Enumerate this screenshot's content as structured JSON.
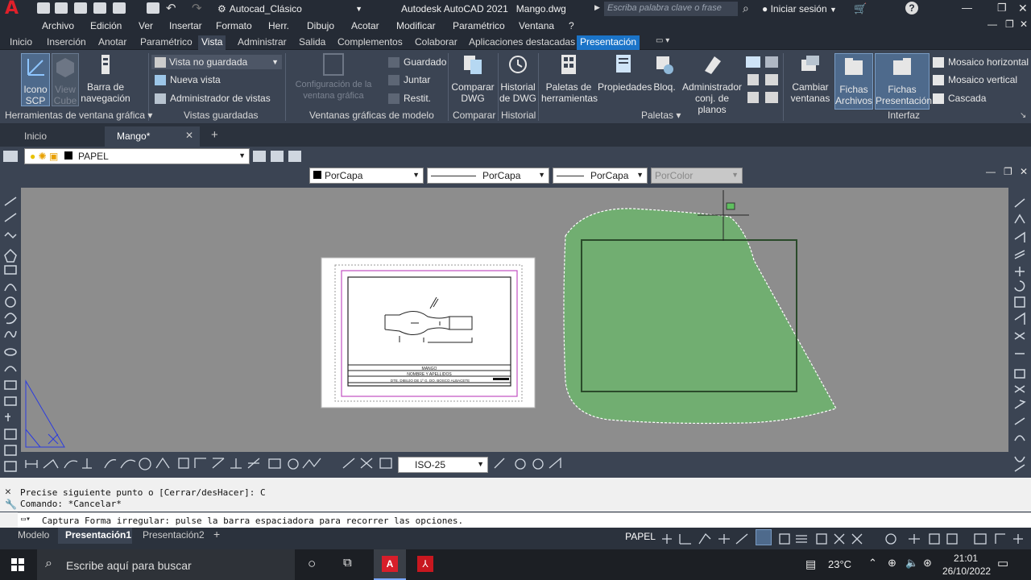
{
  "app": {
    "title": "Autodesk AutoCAD 2021",
    "filename": "Mango.dwg",
    "workspace": "Autocad_Clásico",
    "search_placeholder": "Escriba palabra clave o frase",
    "signin": "Iniciar sesión"
  },
  "menubar": [
    "Archivo",
    "Edición",
    "Ver",
    "Insertar",
    "Formato",
    "Herr.",
    "Dibujo",
    "Acotar",
    "Modificar",
    "Paramétrico",
    "Ventana",
    "?"
  ],
  "ribbon_tabs": [
    "Inicio",
    "Inserción",
    "Anotar",
    "Paramétrico",
    "Vista",
    "Administrar",
    "Salida",
    "Complementos",
    "Colaborar",
    "Aplicaciones destacadas",
    "Presentación"
  ],
  "ribbon": {
    "icono_scp": "Icono\nSCP",
    "view_cube": "View\nCube",
    "barra_nav": "Barra de\nnavegación",
    "vista_no_guardada": "Vista no guardada",
    "nueva_vista": "Nueva vista",
    "admin_vistas": "Administrador de vistas",
    "config_ventana": "Configuración de la\nventana gráfica",
    "guardado": "Guardado",
    "juntar": "Juntar",
    "restit": "Restit.",
    "comparar_dwg": "Comparar\nDWG",
    "historial_dwg": "Historial\nde DWG",
    "paletas_herr": "Paletas de\nherramientas",
    "propiedades": "Propiedades",
    "bloq": "Bloq.",
    "admin_conj": "Administrador\nconj. de planos",
    "cambiar_ventanas": "Cambiar\nventanas",
    "fichas_archivos": "Fichas\nArchivos",
    "fichas_presentacion": "Fichas\nPresentación",
    "mosaico_h": "Mosaico horizontal",
    "mosaico_v": "Mosaico vertical",
    "cascada": "Cascada",
    "panels": {
      "herr_ventana": "Herramientas de ventana gráfica",
      "vistas_guardadas": "Vistas guardadas",
      "ventanas_modelo": "Ventanas gráficas de modelo",
      "comparar": "Comparar",
      "historial": "Historial",
      "paletas": "Paletas",
      "interfaz": "Interfaz"
    }
  },
  "doc_tabs": [
    "Inicio",
    "Mango*"
  ],
  "layer": {
    "name": "PAPEL"
  },
  "props": {
    "color": "PorCapa",
    "linetype": "PorCapa",
    "lineweight": "PorCapa",
    "plotstyle": "PorColor"
  },
  "drawing": {
    "title_line1": "MANGO",
    "title_line2": "NOMBRE Y APELLIDOS",
    "title_line3": "DTE. DIBUJO DE 1º G. DO. BOSCO ALBACETE"
  },
  "dim_style": "ISO-25",
  "command": {
    "history": [
      "Precise siguiente punto o [Cerrar/desHacer]: C",
      "Comando: *Cancelar*"
    ],
    "current": "Captura Forma irregular: pulse la barra espaciadora para recorrer las opciones."
  },
  "layout_tabs": [
    "Modelo",
    "Presentación1",
    "Presentación2"
  ],
  "status": {
    "space": "PAPEL"
  },
  "taskbar": {
    "search": "Escribe aquí para buscar",
    "temp": "23°C",
    "time": "21:01",
    "date": "26/10/2022"
  },
  "colors": {
    "accent": "#1b74c8",
    "selection_fill": "#6db36d",
    "canvas": "#8d8d8d"
  }
}
